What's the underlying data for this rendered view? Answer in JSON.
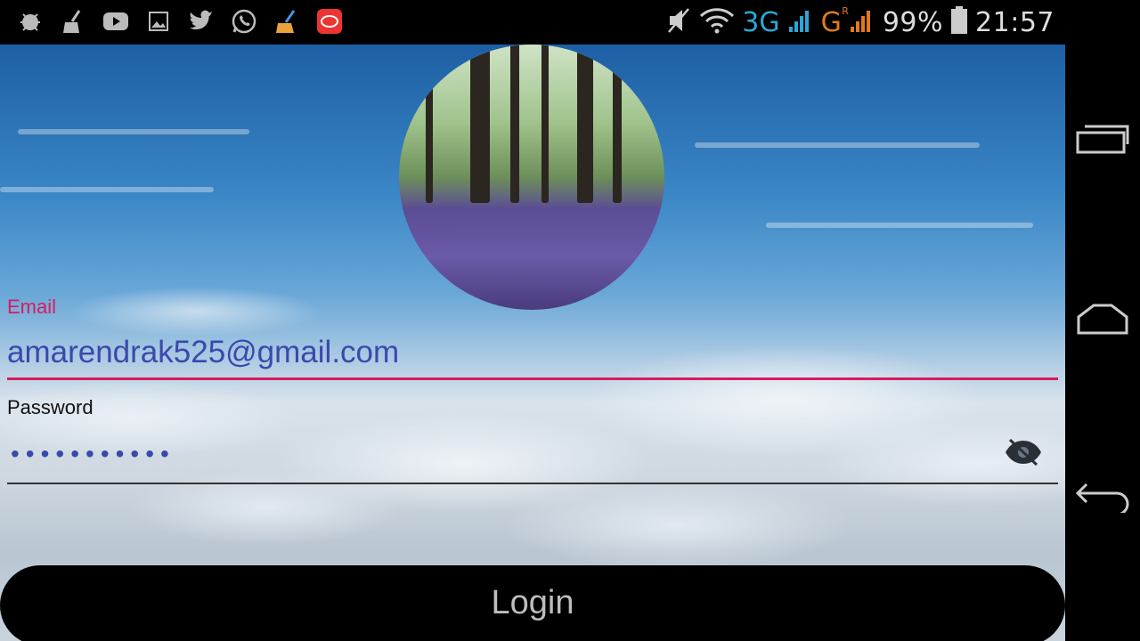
{
  "status_bar": {
    "left_icons": [
      "bug-icon",
      "broom-icon",
      "youtube-icon",
      "image-icon",
      "twitter-icon",
      "whatsapp-icon",
      "cleaner-icon",
      "app-icon"
    ],
    "network_3g": "3G",
    "network_g": "G",
    "roaming": "R",
    "battery": "99%",
    "time": "21:57"
  },
  "login_form": {
    "email_label": "Email",
    "email_value": "amarendrak525@gmail.com",
    "password_label": "Password",
    "password_mask": "•••••••••••",
    "login_label": "Login"
  },
  "colors": {
    "accent": "#d81b60",
    "input_text": "#3949ab",
    "button_bg": "#000000",
    "button_text": "#bdbdbd"
  },
  "nav_bar": {
    "icons": [
      "recent-apps-icon",
      "home-icon",
      "back-icon"
    ]
  }
}
